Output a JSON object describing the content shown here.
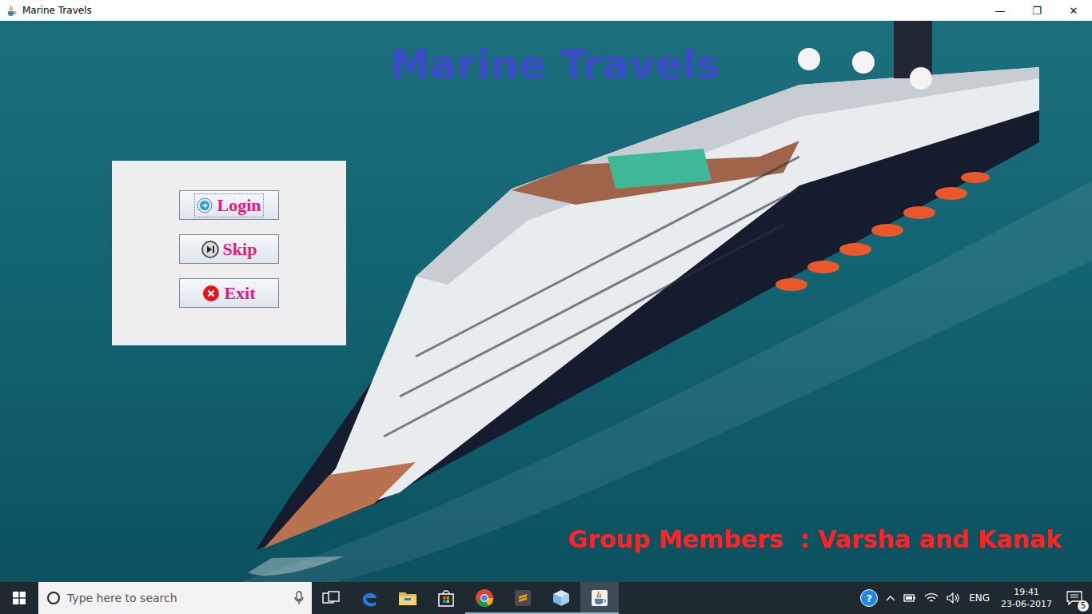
{
  "window": {
    "title": "Marine Travels",
    "controls": [
      "—",
      "❐",
      "✕"
    ]
  },
  "heading": "Marine Travels",
  "menu": {
    "buttons": [
      {
        "label": "Login",
        "kind": "login",
        "focused": true
      },
      {
        "label": "Skip",
        "kind": "skip",
        "focused": false
      },
      {
        "label": "Exit",
        "kind": "exit",
        "focused": false
      }
    ]
  },
  "credits": "Group Members  : Varsha and Kanak",
  "taskbar": {
    "search": {
      "placeholder": "Type here to search"
    },
    "apps": [
      {
        "kind": "task-view",
        "running": false,
        "selected": false
      },
      {
        "kind": "edge",
        "running": false,
        "selected": false
      },
      {
        "kind": "explorer",
        "running": false,
        "selected": false
      },
      {
        "kind": "store",
        "running": false,
        "selected": false
      },
      {
        "kind": "chrome",
        "running": true,
        "selected": false
      },
      {
        "kind": "sublime",
        "running": true,
        "selected": false
      },
      {
        "kind": "cube",
        "running": true,
        "selected": false
      },
      {
        "kind": "java",
        "running": true,
        "selected": true
      }
    ],
    "tray": {
      "help": "?",
      "language": "ENG",
      "time": "19:41",
      "date": "23-06-2017",
      "notifications": "5"
    }
  }
}
